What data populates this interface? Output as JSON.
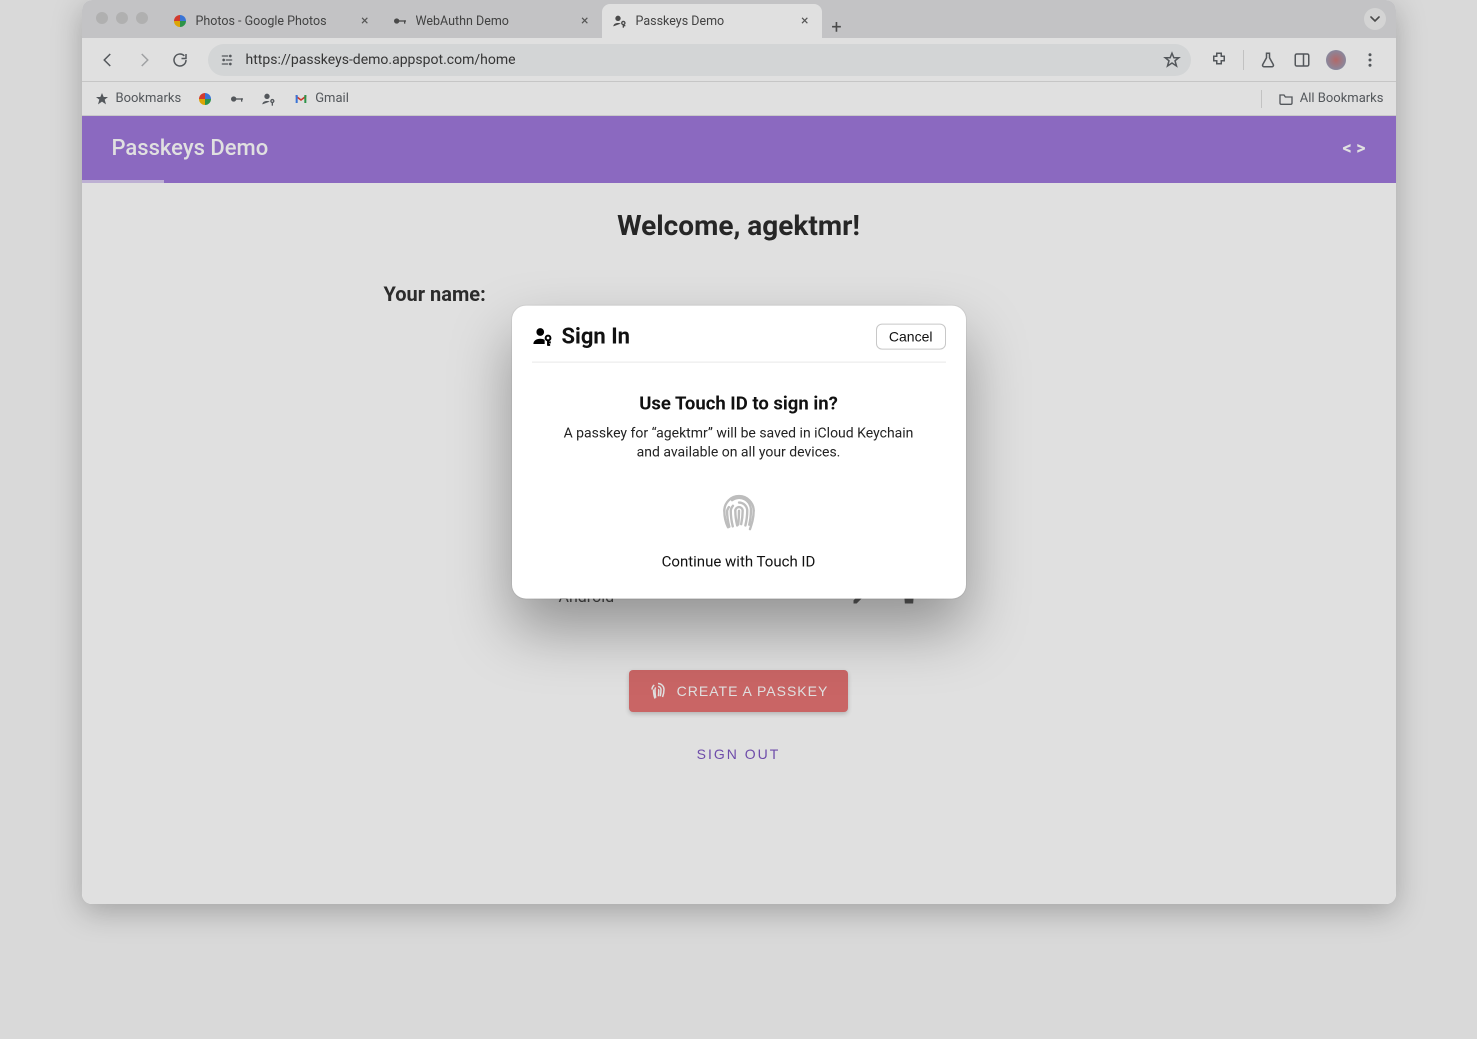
{
  "tabs": [
    {
      "title": "Photos - Google Photos",
      "active": false,
      "iconColor": "multicolor"
    },
    {
      "title": "WebAuthn Demo",
      "active": false
    },
    {
      "title": "Passkeys Demo",
      "active": true
    }
  ],
  "address": {
    "url": "https://passkeys-demo.appspot.com/home"
  },
  "bookmarks": {
    "label": "Bookmarks",
    "gmail": "Gmail",
    "allBookmarks": "All Bookmarks"
  },
  "page": {
    "appTitle": "Passkeys Demo",
    "welcome": "Welcome, agektmr!",
    "yourNameLabel": "Your name:",
    "passkeys": [
      {
        "name": "Android"
      }
    ],
    "createPasskey": "CREATE A PASSKEY",
    "signOut": "SIGN OUT"
  },
  "modal": {
    "title": "Sign In",
    "cancel": "Cancel",
    "question": "Use Touch ID to sign in?",
    "description": "A passkey for “agektmr” will be saved in iCloud Keychain and available on all your devices.",
    "continue": "Continue with Touch ID"
  }
}
